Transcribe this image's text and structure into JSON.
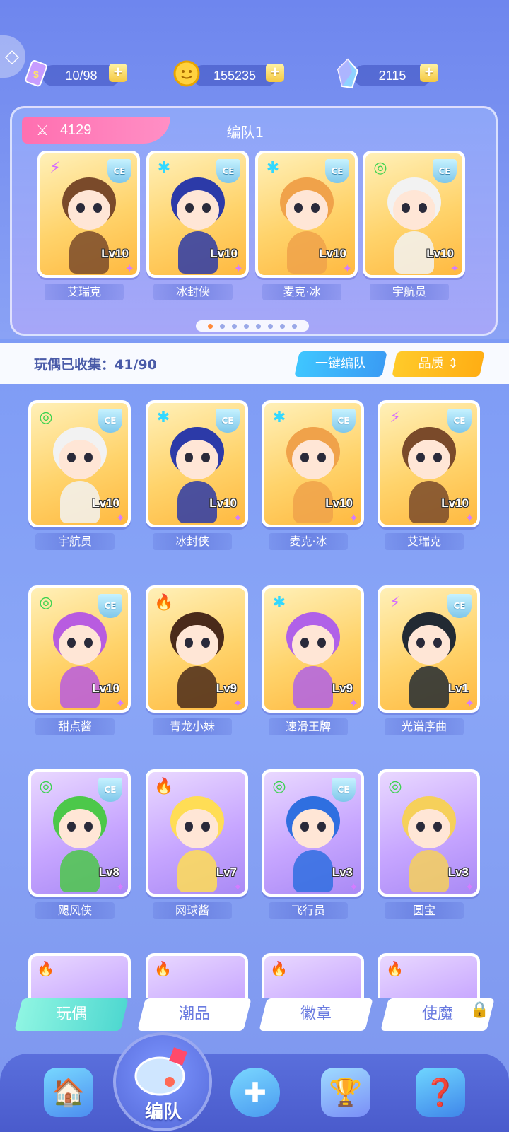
{
  "currencies": {
    "stamina": "10/98",
    "coins": "155235",
    "gems": "2115"
  },
  "team": {
    "power": "4129",
    "name": "编队1",
    "members": [
      {
        "name": "艾瑞克",
        "level": "Lv10",
        "element": "lightning",
        "quality": "gold",
        "ce": true
      },
      {
        "name": "冰封侠",
        "level": "Lv10",
        "element": "ice",
        "quality": "gold",
        "ce": true
      },
      {
        "name": "麦克·冰",
        "level": "Lv10",
        "element": "ice",
        "quality": "gold",
        "ce": true
      },
      {
        "name": "宇航员",
        "level": "Lv10",
        "element": "wind",
        "quality": "gold",
        "ce": true
      }
    ],
    "pages": 8,
    "active_page": 0
  },
  "collection": {
    "label": "玩偶已收集：41/90",
    "one_key_button": "一键编队",
    "quality_button": "品质"
  },
  "dolls": [
    {
      "name": "宇航员",
      "level": "Lv10",
      "element": "wind",
      "quality": "gold",
      "ce": true
    },
    {
      "name": "冰封侠",
      "level": "Lv10",
      "element": "ice",
      "quality": "gold",
      "ce": true
    },
    {
      "name": "麦克·冰",
      "level": "Lv10",
      "element": "ice",
      "quality": "gold",
      "ce": true
    },
    {
      "name": "艾瑞克",
      "level": "Lv10",
      "element": "lightning",
      "quality": "gold",
      "ce": true
    },
    {
      "name": "甜点酱",
      "level": "Lv10",
      "element": "wind",
      "quality": "gold",
      "ce": true
    },
    {
      "name": "青龙小妹",
      "level": "Lv9",
      "element": "fire",
      "quality": "gold",
      "ce": false
    },
    {
      "name": "速滑王牌",
      "level": "Lv9",
      "element": "ice",
      "quality": "gold",
      "ce": false
    },
    {
      "name": "光谱序曲",
      "level": "Lv1",
      "element": "lightning",
      "quality": "gold",
      "ce": true
    },
    {
      "name": "飓风侠",
      "level": "Lv8",
      "element": "wind",
      "quality": "purple",
      "ce": true
    },
    {
      "name": "网球酱",
      "level": "Lv7",
      "element": "fire",
      "quality": "purple",
      "ce": false
    },
    {
      "name": "飞行员",
      "level": "Lv3",
      "element": "wind",
      "quality": "purple",
      "ce": true
    },
    {
      "name": "圆宝",
      "level": "Lv3",
      "element": "wind",
      "quality": "purple",
      "ce": false
    }
  ],
  "category_tabs": [
    "玩偶",
    "潮品",
    "徽章",
    "使魔"
  ],
  "nav": {
    "center_label": "编队"
  },
  "colors": {
    "power_tag": "#ff6fb0",
    "one_key": "#3fc6ff",
    "quality": "#ffbf20",
    "active_tab": "#4fd8d0"
  }
}
